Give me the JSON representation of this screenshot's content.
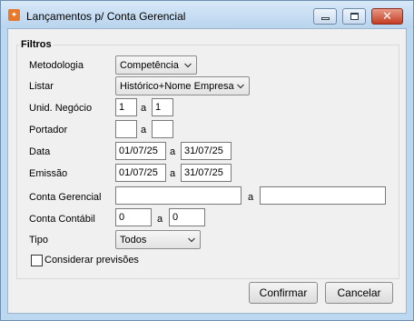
{
  "window": {
    "title": "Lançamentos p/ Conta Gerencial"
  },
  "filters": {
    "group_title": "Filtros",
    "metodologia": {
      "label": "Metodologia",
      "value": "Competência"
    },
    "listar": {
      "label": "Listar",
      "value": "Histórico+Nome Empresa"
    },
    "unid_negocio": {
      "label": "Unid. Negócio",
      "from": "1",
      "sep": "a",
      "to": "1"
    },
    "portador": {
      "label": "Portador",
      "from": "",
      "sep": "a",
      "to": ""
    },
    "data": {
      "label": "Data",
      "from": "01/07/25",
      "sep": "a",
      "to": "31/07/25"
    },
    "emissao": {
      "label": "Emissão",
      "from": "01/07/25",
      "sep": "a",
      "to": "31/07/25"
    },
    "conta_gerencial": {
      "label": "Conta Gerencial",
      "from": "",
      "sep": "a",
      "to": ""
    },
    "conta_contabil": {
      "label": "Conta Contábil",
      "from": "0",
      "sep": "a",
      "to": "0"
    },
    "tipo": {
      "label": "Tipo",
      "value": "Todos"
    },
    "considerar_previsoes": {
      "label": "Considerar previsões",
      "checked": false
    }
  },
  "buttons": {
    "confirm": "Confirmar",
    "cancel": "Cancelar"
  },
  "icons": {
    "app": "app-logo-icon",
    "minimize": "minimize-icon",
    "maximize": "maximize-icon",
    "close": "close-icon",
    "dropdown": "chevron-down-icon"
  }
}
